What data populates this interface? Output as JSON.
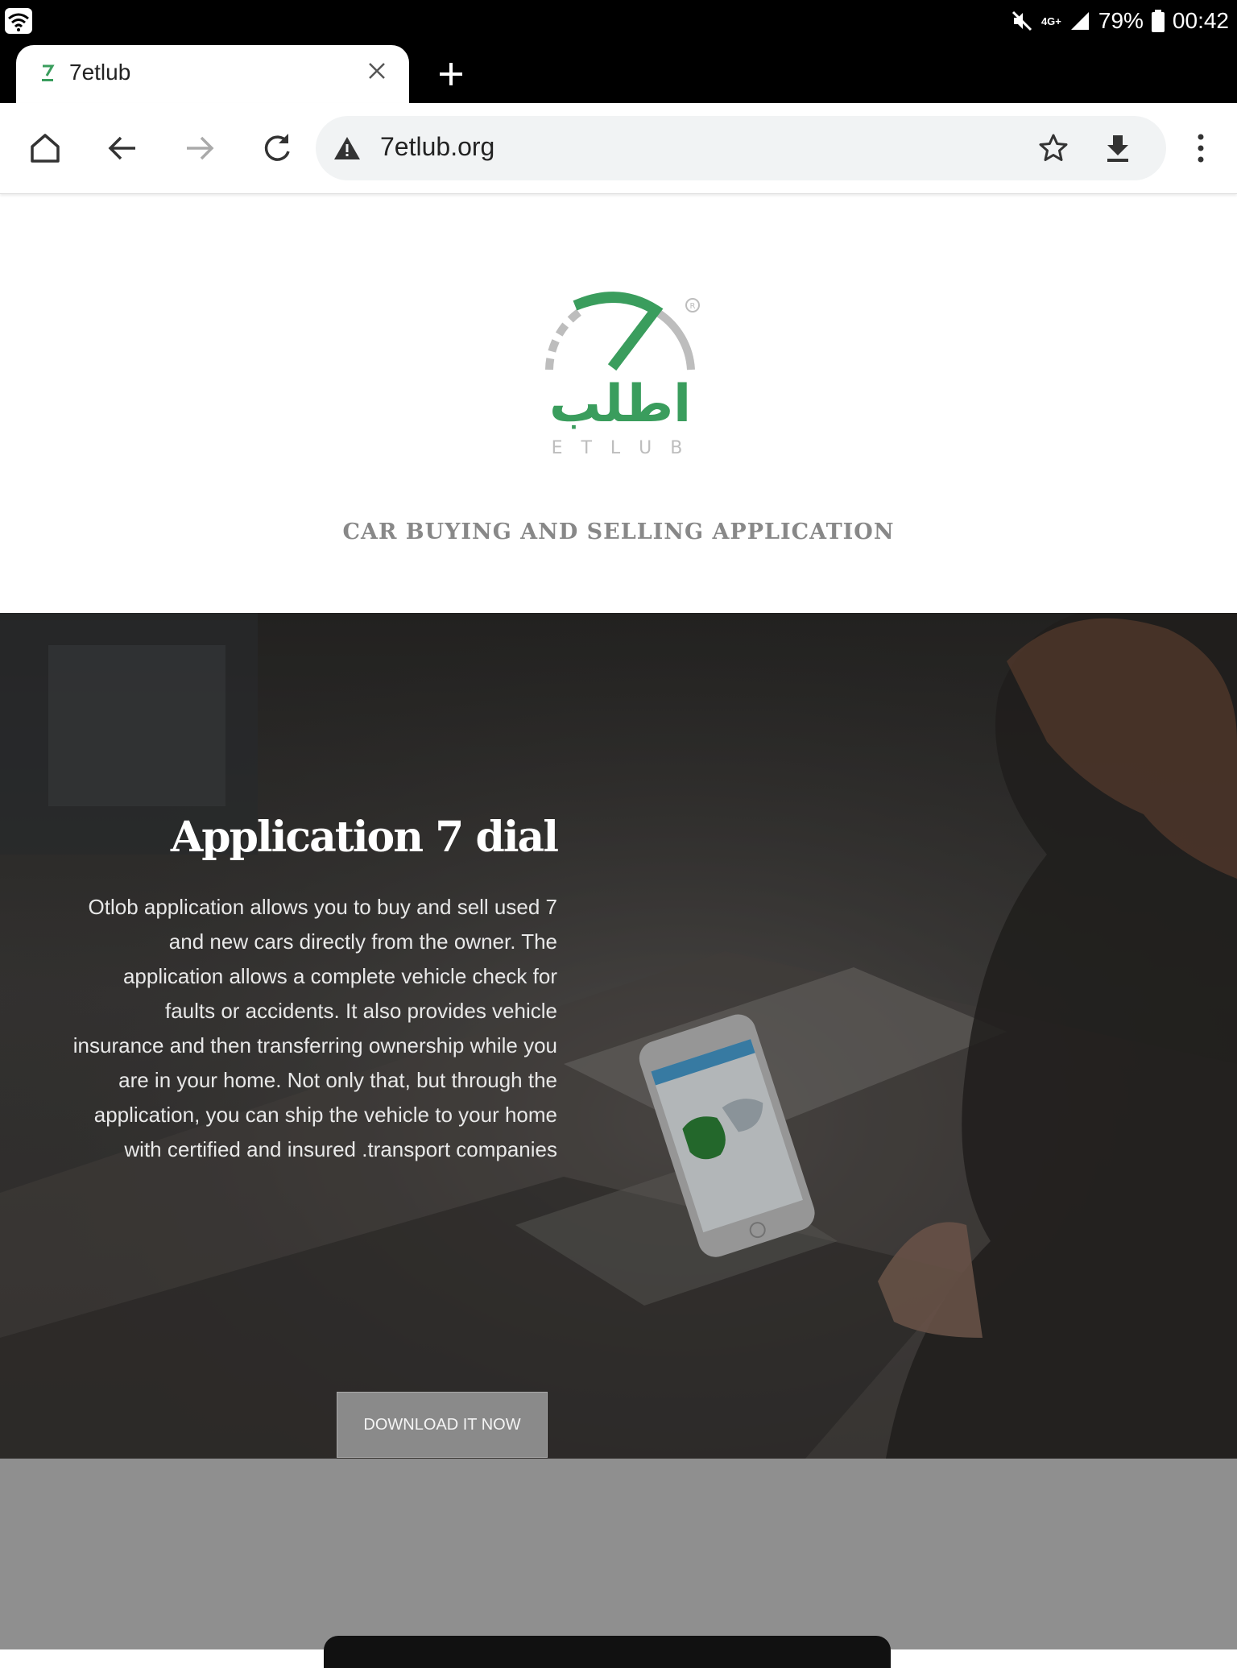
{
  "status_bar": {
    "network": "4G+",
    "battery": "79%",
    "time": "00:42"
  },
  "browser": {
    "tab_title": "7etlub",
    "url": "7etlub.org"
  },
  "logo": {
    "arabic_text": "اطلب",
    "latin_text": "E T L U B",
    "brand_color": "#3a9d5d"
  },
  "page": {
    "tagline": "CAR BUYING AND SELLING APPLICATION",
    "hero": {
      "title": "Application 7 dial",
      "body": "Otlob application allows you to buy and sell used 7 and new cars directly from the owner. The application allows a complete vehicle check for faults or accidents. It also provides vehicle insurance and then transferring ownership while you are in your home. Not only that, but through the application, you can ship the vehicle to your home with certified and insured .transport companies",
      "button_label": "DOWNLOAD IT NOW"
    }
  },
  "icons": [
    "wifi-icon",
    "mute-icon",
    "signal-icon",
    "battery-icon",
    "close-icon",
    "plus-icon",
    "home-icon",
    "back-icon",
    "forward-icon",
    "reload-icon",
    "warning-icon",
    "star-icon",
    "download-icon",
    "more-vert-icon"
  ]
}
